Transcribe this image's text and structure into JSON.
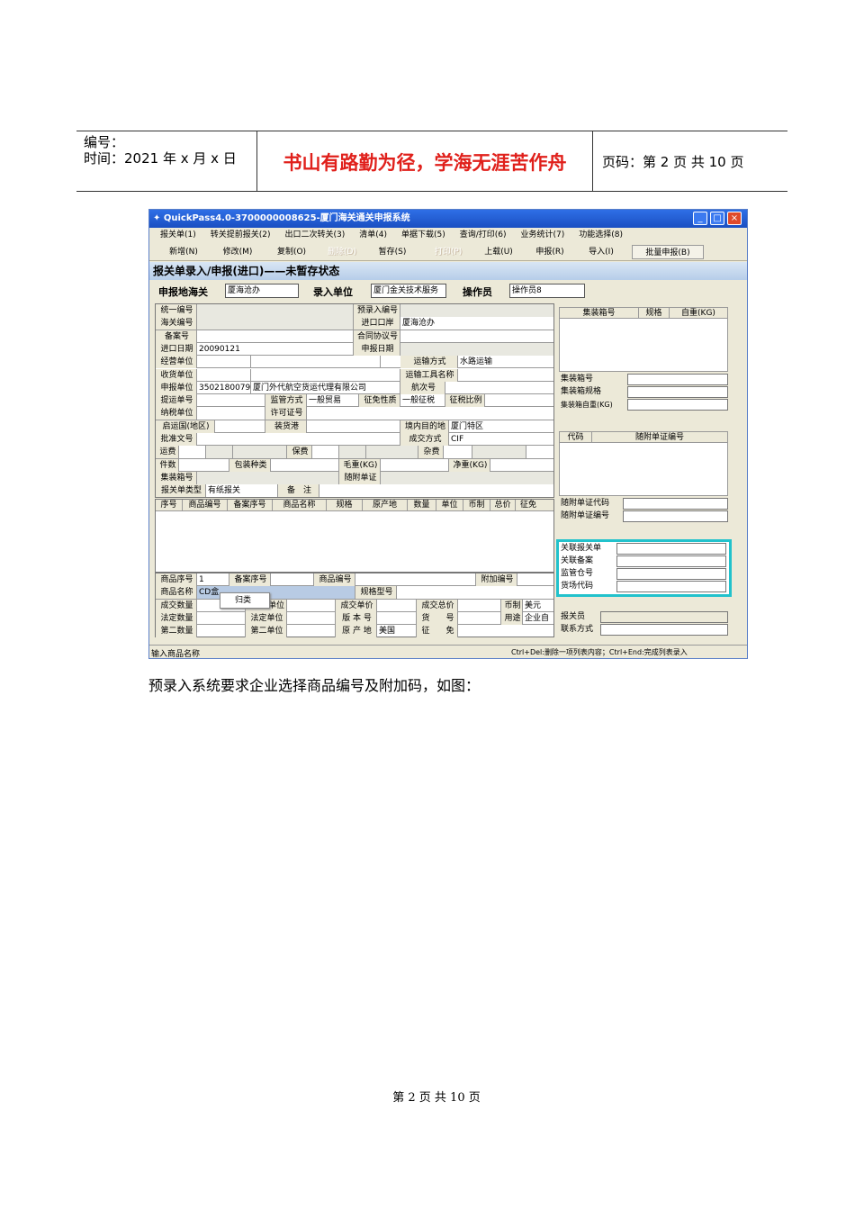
{
  "header": {
    "line1": "编号：",
    "line2": "时间：2021 年 x 月 x 日",
    "motto": "书山有路勤为径，学海无涯苦作舟",
    "page": "页码：第 2 页  共 10 页"
  },
  "window": {
    "title": "QuickPass4.0-3700000008625-厦门海关通关申报系统",
    "menus": [
      "报关单(1)",
      "转关提前报关(2)",
      "出口二次转关(3)",
      "清单(4)",
      "单据下载(5)",
      "查询/打印(6)",
      "业务统计(7)",
      "功能选择(8)"
    ],
    "tools": {
      "add": "新增(N)",
      "edit": "修改(M)",
      "copy": "复制(O)",
      "del": "删除(D)",
      "save": "暂存(S)",
      "print": "打印(P)",
      "upload": "上载(U)",
      "declare": "申报(R)",
      "import": "导入(I)",
      "batch": "批量申报(B)"
    },
    "form_title": "报关单录入/申报(进口)——未暂存状态",
    "customs_label": "申报地海关",
    "customs_value": "厦海沧办",
    "entry_unit_label": "录入单位",
    "entry_unit_value": "厦门金关技术服务",
    "operator_label": "操作员",
    "operator_value": "操作员8",
    "f": {
      "l1": "统一编号",
      "l2": "预录入编号",
      "l3": "海关编号",
      "l4": "进口口岸",
      "v4": "厦海沧办",
      "l5": "备案号",
      "l6": "合同协议号",
      "l7": "进口日期",
      "v7": "20090121",
      "l8": "申报日期",
      "l9": "经营单位",
      "l10": "运输方式",
      "v10": "水路运输",
      "l11": "收货单位",
      "l12": "运输工具名称",
      "l13": "申报单位",
      "v13a": "3502180079",
      "v13b": "厦门外代航空货运代理有限公司",
      "l14": "航次号",
      "l15": "提运单号",
      "l16": "监管方式",
      "v16": "一般贸易",
      "l17": "征免性质",
      "v17": "一般征税",
      "l18": "征税比例",
      "l19": "纳税单位",
      "l20": "许可证号",
      "l21": "启运国(地区)",
      "l22": "装货港",
      "l23": "境内目的地",
      "v23": "厦门特区",
      "l24": "批准文号",
      "l25": "成交方式",
      "v25": "CIF",
      "l26": "运费",
      "l27": "保费",
      "l28": "杂费",
      "l29": "件数",
      "l30": "包装种类",
      "l31": "毛重(KG)",
      "l32": "净重(KG)",
      "l33": "集装箱号",
      "l34": "随附单证",
      "l35": "报关单类型",
      "v35": "有纸报关",
      "l36": "备　注"
    },
    "goods_cols": [
      "序号",
      "商品编号",
      "备案序号",
      "商品名称",
      "规格",
      "原产地",
      "数量",
      "单位",
      "币制",
      "总价",
      "征免"
    ],
    "d": {
      "l1": "商品序号",
      "v1": "1",
      "l2": "备案序号",
      "l3": "商品编号",
      "l4": "附加编号",
      "l5": "商品名称",
      "v5": "CD盒",
      "l6": "规格型号",
      "l7": "成交数量",
      "l8": "单位",
      "l9": "成交单价",
      "l10": "成交总价",
      "l11": "币制",
      "v11": "美元",
      "l12": "法定数量",
      "l13": "法定单位",
      "l14": "版 本 号",
      "l15": "货　　号",
      "l16": "用途",
      "v16": "企业自",
      "l17": "第二数量",
      "l18": "第二单位",
      "l19": "原 产 地",
      "v19": "美国",
      "l20": "征　　免"
    },
    "popup": "归类",
    "right": {
      "c1": "集装箱号",
      "c2": "规格",
      "c3": "自重(KG)",
      "r1": "集装箱号",
      "r2": "集装箱规格",
      "r3": "集装箱自重(KG)",
      "d1": "代码",
      "d2": "随附单证编号",
      "s1": "随附单证代码",
      "s2": "随附单证编号",
      "k1": "关联报关单",
      "k2": "关联备案",
      "k3": "监管仓号",
      "k4": "货场代码",
      "b1": "报关员",
      "b2": "联系方式"
    },
    "status_left": "输入商品名称",
    "status_right": "Ctrl+Del:删除一项列表内容；Ctrl+End:完成列表录入"
  },
  "paragraph": "预录入系统要求企业选择商品编号及附加码，如图：",
  "footer": "第  2  页  共  10  页"
}
